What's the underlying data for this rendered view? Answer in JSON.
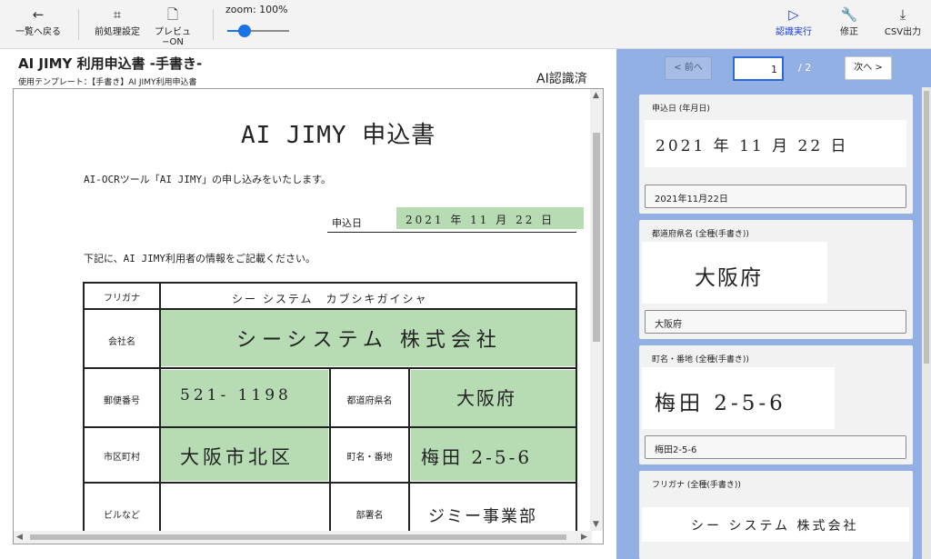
{
  "toolbar": {
    "back_label": "一覧へ戻る",
    "preprocess_label": "前処理設定",
    "preview_label": "プレビュ−ON",
    "zoom_label": "zoom:  100%",
    "zoom_value": 100,
    "recognize_label": "認識実行",
    "edit_label": "修正",
    "csv_label": "CSV出力",
    "accent_color": "#1a3de0"
  },
  "document": {
    "title": "AI JIMY 利用申込書 -手書き-",
    "template": "使用テンプレート：【手書き】AI JIMY利用申込書",
    "status": "AI認識済"
  },
  "form": {
    "heading": "AI JIMY 申込書",
    "intro": "AI-OCRツール「AI JIMY」の申し込みをいたします。",
    "date_label": "申込日",
    "date_hand": "2021 年 11 月 22 日",
    "note": "下記に、AI JIMY利用者の情報をご記載ください。",
    "furigana_label": "フリガナ",
    "furigana_value": "シー システム　カブシキガイシャ",
    "company_label": "会社名",
    "company_value": "シーシステム 株式会社",
    "postal_label": "郵便番号",
    "postal_value": "521- 1198",
    "prefecture_label": "都道府県名",
    "prefecture_value": "大阪府",
    "city_label": "市区町村",
    "city_value": "大阪市北区",
    "town_label": "町名・番地",
    "town_value": "梅田 2-5-6",
    "building_label": "ビルなど",
    "dept_label": "部署名",
    "dept_value": "ジミー事業部",
    "highlight_color": "#b7dcb4"
  },
  "pager": {
    "prev_label": "< 前へ",
    "current_page": "1",
    "total": "/  2",
    "next_label": "次へ >"
  },
  "fields": [
    {
      "title": "申込日 (年月日)",
      "hand": "2021 年 11 月 22 日",
      "value": "2021年11月22日"
    },
    {
      "title": "都道府県名 (全種(手書き))",
      "hand": "大阪府",
      "value": "大阪府"
    },
    {
      "title": "町名・番地 (全種(手書き))",
      "hand": "梅田 2-5-6",
      "value": "梅田2-5-6"
    },
    {
      "title": "フリガナ (全種(手書き))",
      "hand": "シー システム 株式会社",
      "value": ""
    }
  ],
  "icons": {
    "back": "arrow-left-icon",
    "crop": "crop-icon",
    "preview": "document-icon",
    "recognize": "play-icon",
    "edit": "wrench-icon",
    "csv": "download-icon"
  }
}
